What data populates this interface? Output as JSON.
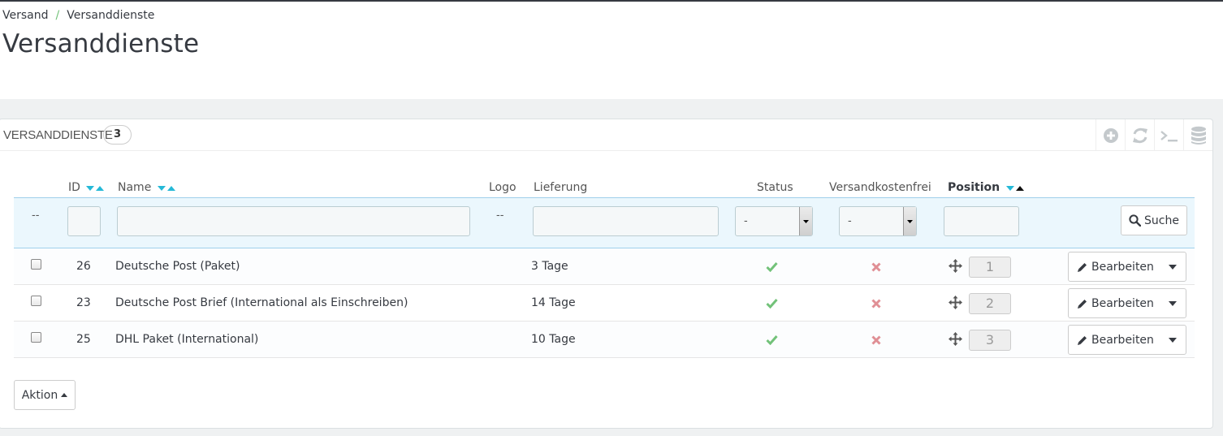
{
  "breadcrumb": {
    "parent": "Versand",
    "separator": "/",
    "current": "Versanddienste"
  },
  "page_title": "Versanddienste",
  "panel": {
    "title": "VERSANDDIENSTE",
    "count": "3",
    "toolbar_icons": [
      "add-icon",
      "refresh-icon",
      "sql-query-icon",
      "export-database-icon"
    ]
  },
  "columns": {
    "id": "ID",
    "name": "Name",
    "logo": "Logo",
    "delivery": "Lieferung",
    "status": "Status",
    "free_shipping": "Versandkostenfrei",
    "position": "Position"
  },
  "filters": {
    "bulk_placeholder": "--",
    "logo_placeholder": "--",
    "status_selected": "-",
    "free_shipping_selected": "-",
    "search_label": "Suche"
  },
  "rows": [
    {
      "id": "26",
      "name": "Deutsche Post (Paket)",
      "delivery": "3 Tage",
      "status": "enabled",
      "free_shipping": "no",
      "position": "1",
      "edit_label": "Bearbeiten"
    },
    {
      "id": "23",
      "name": "Deutsche Post Brief (International als Einschreiben)",
      "delivery": "14 Tage",
      "status": "enabled",
      "free_shipping": "no",
      "position": "2",
      "edit_label": "Bearbeiten"
    },
    {
      "id": "25",
      "name": "DHL Paket (International)",
      "delivery": "10 Tage",
      "status": "enabled",
      "free_shipping": "no",
      "position": "3",
      "edit_label": "Bearbeiten"
    }
  ],
  "bulk_action_label": "Aktion",
  "colors": {
    "accent": "#25b9d7",
    "success": "#72c279",
    "danger": "#e08f95",
    "header_dark": "#363a41"
  }
}
